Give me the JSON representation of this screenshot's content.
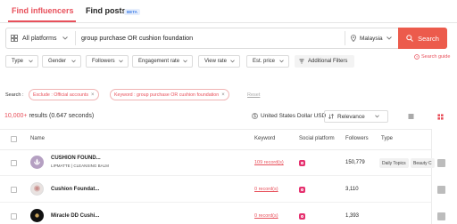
{
  "tabs": {
    "find_influencers": "Find influencers",
    "find_posts": "Find posts",
    "beta_badge": "BETA"
  },
  "search": {
    "platform": "All platforms",
    "query": "group purchase OR cushion foundation",
    "country": "Malaysia",
    "button": "Search"
  },
  "filters": [
    "Type",
    "Gender",
    "Followers",
    "Engagement rate",
    "View rate",
    "Est. price"
  ],
  "additional_filters": "Additional Filters",
  "search_guide": "Search guide",
  "active_search": {
    "label": "Search :",
    "chips": [
      "Exclude : Official accounts",
      "Keyword : group purchase OR cushion foundation"
    ],
    "reset": "Reset"
  },
  "results": {
    "count": "10,000+",
    "text": " results (0.647 seconds)"
  },
  "currency": "United States Dollar USD",
  "sort": "Relevance",
  "columns": {
    "name": "Name",
    "keyword": "Keyword",
    "social_platform": "Social platform",
    "followers": "Followers",
    "type": "Type"
  },
  "rows": [
    {
      "name": "CUSHION FOUND...",
      "subtitle": "LIPMATTE  |  CLEANSING BALM",
      "keyword": "109 record(s)",
      "followers": "150,779",
      "tags": [
        "Daily Topics",
        "Beauty C"
      ]
    },
    {
      "name": "Cushion Foundat...",
      "subtitle": "",
      "keyword": "0 record(s)",
      "followers": "3,110",
      "tags": []
    },
    {
      "name": "Miracle DD Cushi...",
      "subtitle": "",
      "keyword": "0 record(s)",
      "followers": "1,393",
      "tags": []
    }
  ],
  "colors": {
    "accent": "#e8505b",
    "search_button": "#ec5b4c",
    "instagram": "#e5306e"
  },
  "icons": [
    "grid-icon",
    "chevron-down-icon",
    "location-pin-icon",
    "search-icon",
    "filter-icon",
    "help-icon",
    "dollar-icon",
    "sort-icon",
    "list-view-icon",
    "grid-view-icon",
    "instagram-icon"
  ]
}
